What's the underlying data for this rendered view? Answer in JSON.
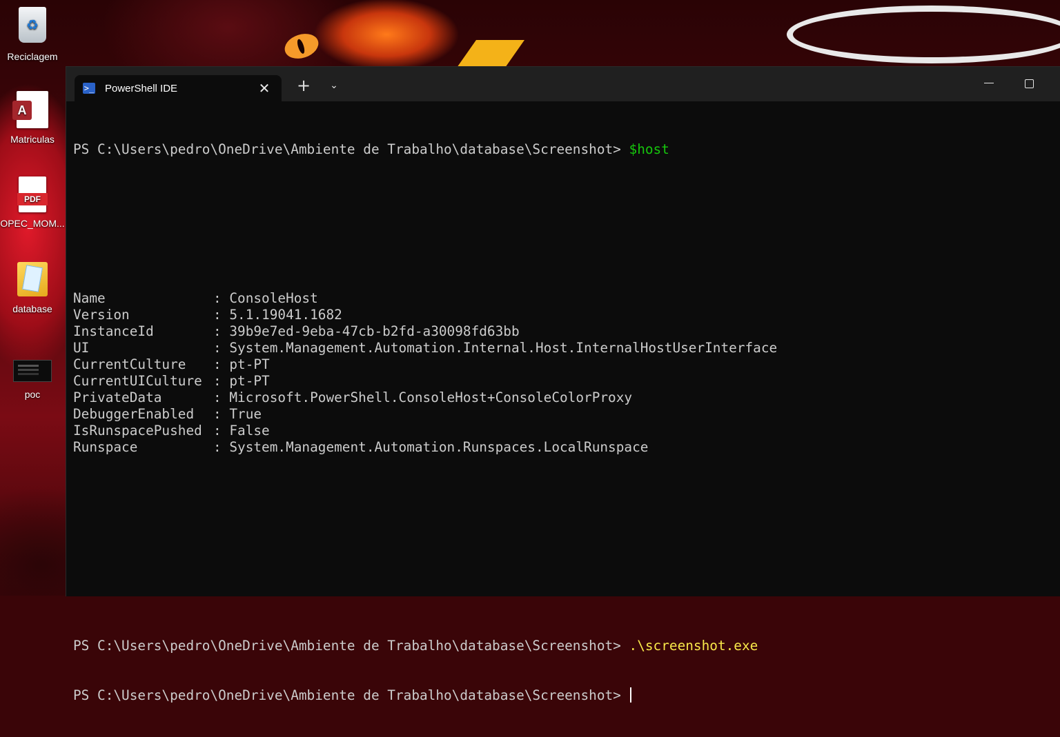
{
  "desktop": {
    "icons": [
      {
        "label": "Reciclagem",
        "icon": "recycle-bin-icon"
      },
      {
        "label": "Matriculas",
        "icon": "access-database-icon"
      },
      {
        "label": "OPEC_MOM...",
        "icon": "pdf-file-icon",
        "badge": "PDF"
      },
      {
        "label": "database",
        "icon": "folder-icon"
      },
      {
        "label": "poc",
        "icon": "image-thumbnail-icon"
      }
    ]
  },
  "terminal": {
    "tab_title": "PowerShell IDE",
    "tab_icon": "powershell-icon",
    "close_glyph": "✕",
    "new_tab_glyph": "+",
    "dropdown_glyph": "⌄",
    "prompt": "PS C:\\Users\\pedro\\OneDrive\\Ambiente de Trabalho\\database\\Screenshot> ",
    "command1": "$host",
    "properties": [
      {
        "name": "Name",
        "value": "ConsoleHost"
      },
      {
        "name": "Version",
        "value": "5.1.19041.1682"
      },
      {
        "name": "InstanceId",
        "value": "39b9e7ed-9eba-47cb-b2fd-a30098fd63bb"
      },
      {
        "name": "UI",
        "value": "System.Management.Automation.Internal.Host.InternalHostUserInterface"
      },
      {
        "name": "CurrentCulture",
        "value": "pt-PT"
      },
      {
        "name": "CurrentUICulture",
        "value": "pt-PT"
      },
      {
        "name": "PrivateData",
        "value": "Microsoft.PowerShell.ConsoleHost+ConsoleColorProxy"
      },
      {
        "name": "DebuggerEnabled",
        "value": "True"
      },
      {
        "name": "IsRunspacePushed",
        "value": "False"
      },
      {
        "name": "Runspace",
        "value": "System.Management.Automation.Runspaces.LocalRunspace"
      }
    ],
    "separator": ": ",
    "command2": ".\\screenshot.exe",
    "colors": {
      "background": "#0c0c0c",
      "text": "#cccccc",
      "command_green": "#16c60c",
      "command_yellow": "#f9e94a"
    }
  }
}
